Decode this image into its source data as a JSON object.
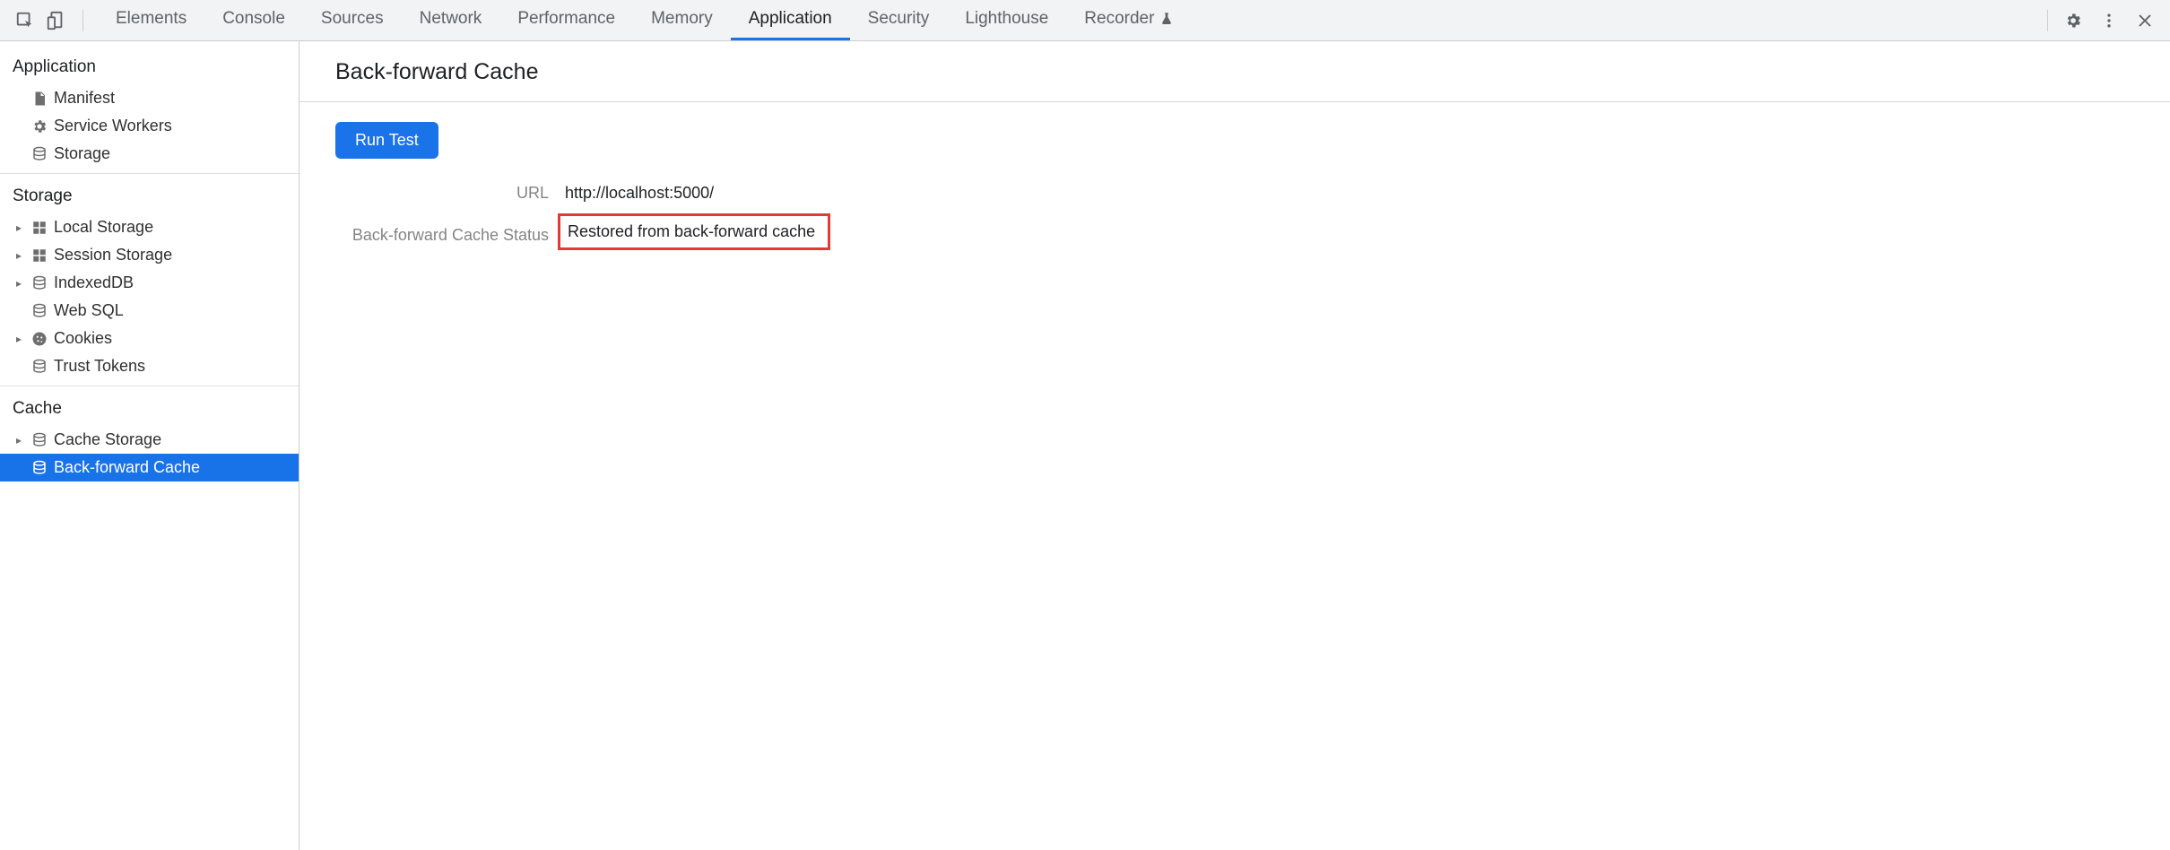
{
  "toolbar": {
    "tabs": [
      "Elements",
      "Console",
      "Sources",
      "Network",
      "Performance",
      "Memory",
      "Application",
      "Security",
      "Lighthouse",
      "Recorder"
    ],
    "active_tab": "Application"
  },
  "sidebar": {
    "sections": [
      {
        "title": "Application",
        "items": [
          {
            "label": "Manifest",
            "icon": "file-icon",
            "expandable": false
          },
          {
            "label": "Service Workers",
            "icon": "gear-icon",
            "expandable": false
          },
          {
            "label": "Storage",
            "icon": "database-icon",
            "expandable": false
          }
        ]
      },
      {
        "title": "Storage",
        "items": [
          {
            "label": "Local Storage",
            "icon": "grid-icon",
            "expandable": true
          },
          {
            "label": "Session Storage",
            "icon": "grid-icon",
            "expandable": true
          },
          {
            "label": "IndexedDB",
            "icon": "database-icon",
            "expandable": true
          },
          {
            "label": "Web SQL",
            "icon": "database-icon",
            "expandable": false
          },
          {
            "label": "Cookies",
            "icon": "cookie-icon",
            "expandable": true
          },
          {
            "label": "Trust Tokens",
            "icon": "database-icon",
            "expandable": false
          }
        ]
      },
      {
        "title": "Cache",
        "items": [
          {
            "label": "Cache Storage",
            "icon": "database-icon",
            "expandable": true
          },
          {
            "label": "Back-forward Cache",
            "icon": "database-icon",
            "expandable": false,
            "selected": true
          }
        ]
      }
    ]
  },
  "content": {
    "title": "Back-forward Cache",
    "run_button_label": "Run Test",
    "rows": [
      {
        "label": "URL",
        "value": "http://localhost:5000/"
      },
      {
        "label": "Back-forward Cache Status",
        "value": "Restored from back-forward cache",
        "highlighted": true
      }
    ]
  }
}
